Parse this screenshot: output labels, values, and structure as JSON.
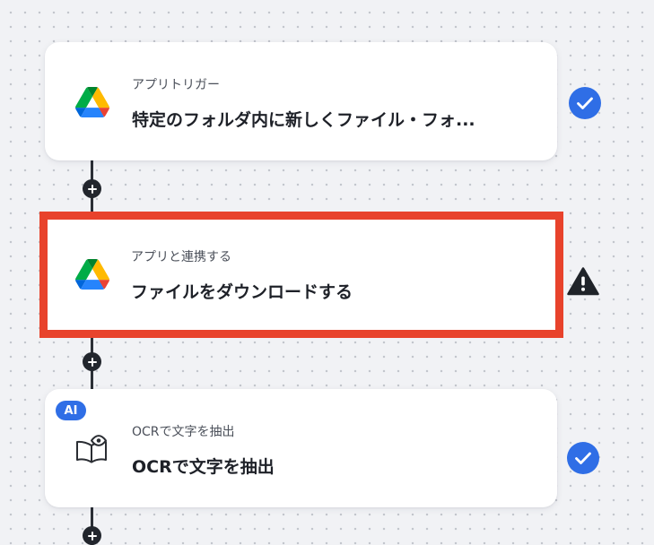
{
  "colors": {
    "accent": "#2f6ee6",
    "highlight_border": "#e8432c",
    "warning": "#1f2329"
  },
  "steps": [
    {
      "type_label": "アプリトリガー",
      "title": "特定のフォルダ内に新しくファイル・フォ...",
      "icon": "google-drive-icon",
      "status": "completed",
      "status_icon": "check-circle-icon"
    },
    {
      "type_label": "アプリと連携する",
      "title": "ファイルをダウンロードする",
      "icon": "google-drive-icon",
      "status": "warning",
      "status_icon": "warning-triangle-icon",
      "highlighted": true
    },
    {
      "badge": "AI",
      "type_label": "OCRで文字を抽出",
      "title": "OCRで文字を抽出",
      "icon": "book-eye-icon",
      "status": "completed",
      "status_icon": "check-circle-icon"
    }
  ],
  "add_step_icon": "plus-icon"
}
